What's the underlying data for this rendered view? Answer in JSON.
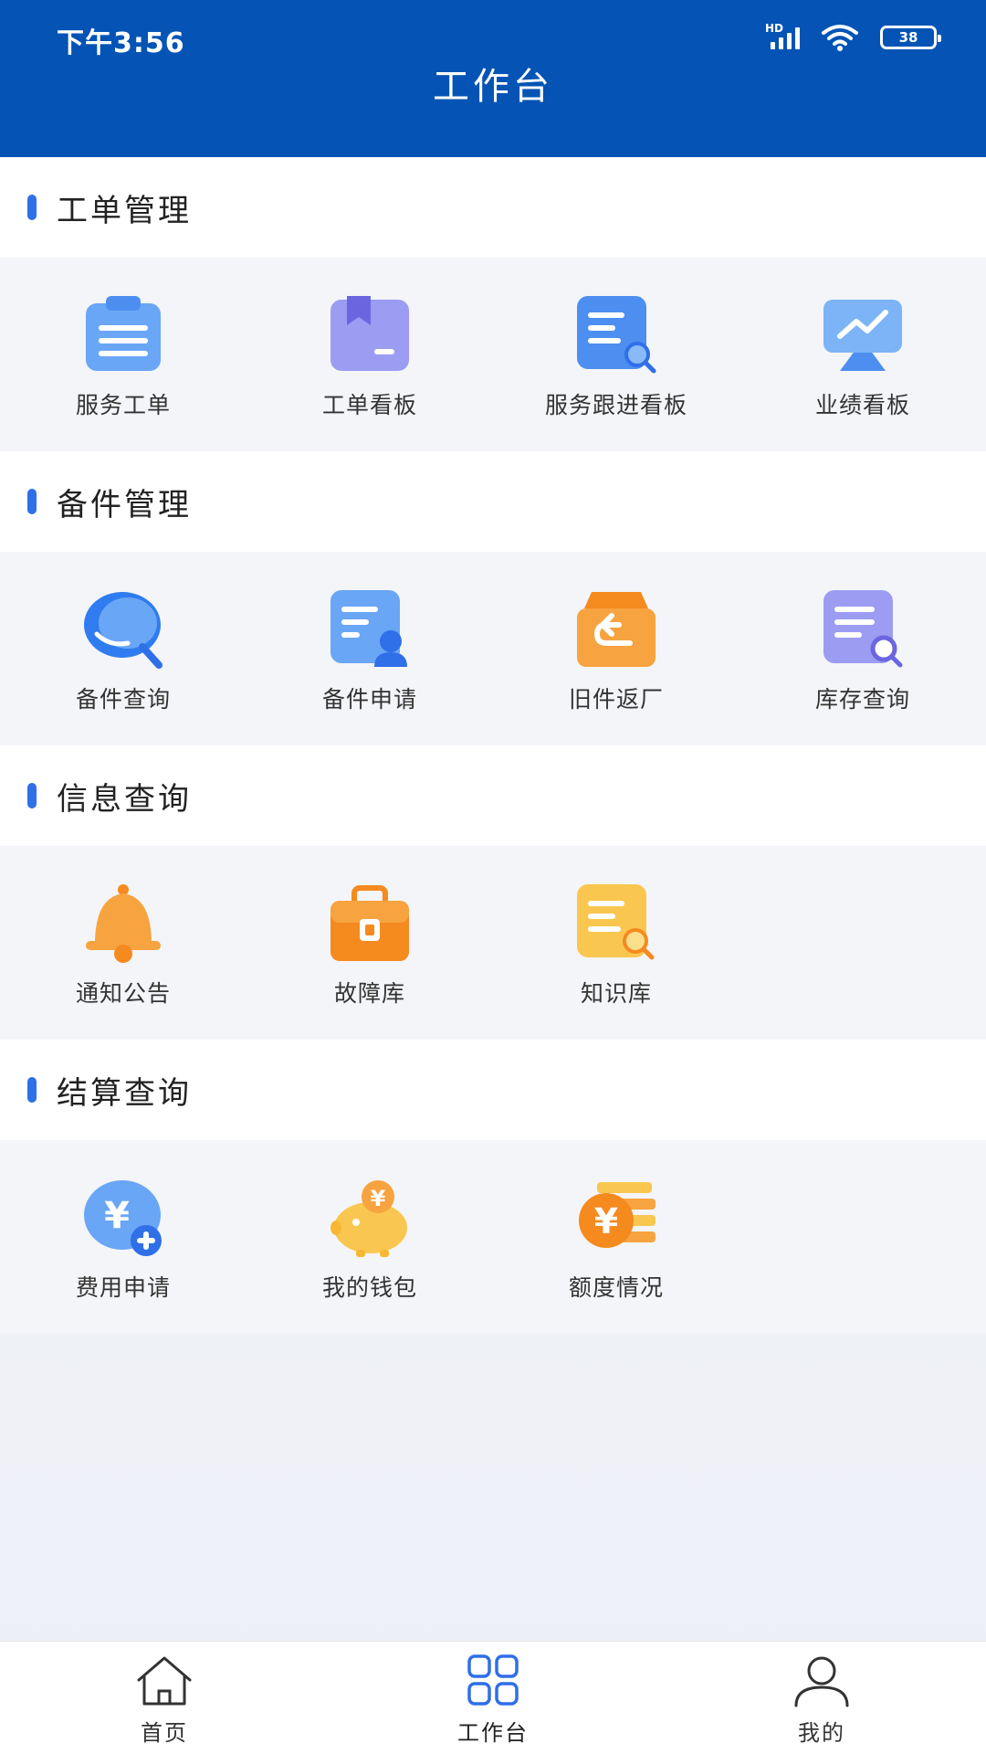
{
  "status_bar": {
    "time": "下午3:56",
    "network_label": "HD",
    "battery": "38",
    "icons": [
      "signal-icon",
      "wifi-icon",
      "battery-icon"
    ]
  },
  "header": {
    "title": "工作台"
  },
  "colors": {
    "header_bg": "#0554b5",
    "accent": "#2f6fe8",
    "nav_active": "#2f6fe8"
  },
  "sections": [
    {
      "title": "工单管理",
      "items": [
        {
          "label": "服务工单",
          "icon": "clipboard-list-icon"
        },
        {
          "label": "工单看板",
          "icon": "bookmark-board-icon"
        },
        {
          "label": "服务跟进看板",
          "icon": "document-search-icon"
        },
        {
          "label": "业绩看板",
          "icon": "trend-chart-icon"
        }
      ]
    },
    {
      "title": "备件管理",
      "items": [
        {
          "label": "备件查询",
          "icon": "chat-search-icon"
        },
        {
          "label": "备件申请",
          "icon": "document-user-icon"
        },
        {
          "label": "旧件返厂",
          "icon": "return-box-icon"
        },
        {
          "label": "库存查询",
          "icon": "inventory-search-icon"
        }
      ]
    },
    {
      "title": "信息查询",
      "items": [
        {
          "label": "通知公告",
          "icon": "bell-icon"
        },
        {
          "label": "故障库",
          "icon": "toolbox-icon"
        },
        {
          "label": "知识库",
          "icon": "knowledge-search-icon"
        }
      ]
    },
    {
      "title": "结算查询",
      "items": [
        {
          "label": "费用申请",
          "icon": "yen-add-icon"
        },
        {
          "label": "我的钱包",
          "icon": "piggy-bank-icon"
        },
        {
          "label": "额度情况",
          "icon": "yen-coins-icon"
        }
      ]
    }
  ],
  "bottom_nav": [
    {
      "label": "首页",
      "icon": "home-icon",
      "active": false
    },
    {
      "label": "工作台",
      "icon": "grid-icon",
      "active": true
    },
    {
      "label": "我的",
      "icon": "user-icon",
      "active": false
    }
  ]
}
